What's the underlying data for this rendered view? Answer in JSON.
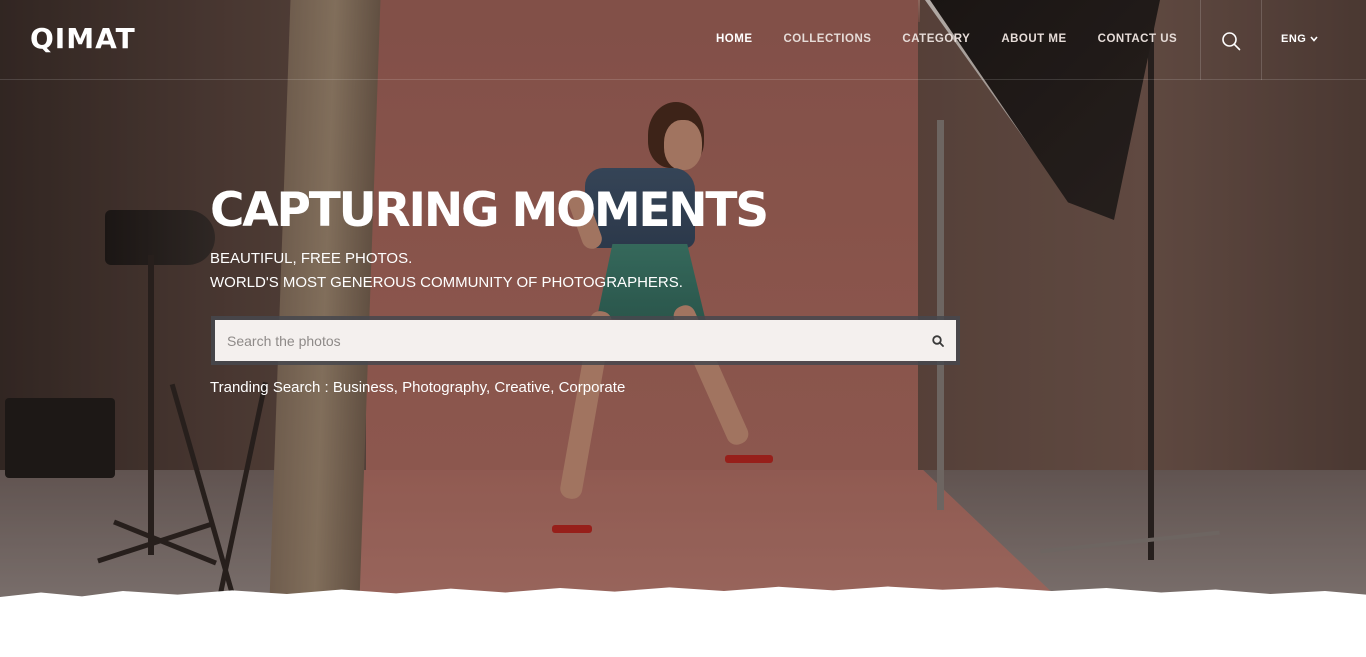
{
  "brand": {
    "logo": "QIMAT"
  },
  "nav": {
    "items": [
      {
        "label": "HOME",
        "active": true
      },
      {
        "label": "COLLECTIONS",
        "active": false
      },
      {
        "label": "CATEGORY",
        "active": false
      },
      {
        "label": "ABOUT ME",
        "active": false
      },
      {
        "label": "CONTACT US",
        "active": false
      }
    ],
    "search_icon": "search-icon",
    "language": {
      "label": "ENG",
      "icon": "chevron-down-icon"
    }
  },
  "hero": {
    "title": "CAPTURING MOMENTS",
    "subtitle_line1": "BEAUTIFUL, FREE PHOTOS.",
    "subtitle_line2": "WORLD'S MOST GENEROUS COMMUNITY OF PHOTOGRAPHERS.",
    "search": {
      "placeholder": "Search the photos",
      "value": "",
      "icon": "search-icon"
    },
    "trending": {
      "label": "Tranding Search :",
      "terms": [
        "Business",
        "Photography",
        "Creative",
        "Corporate"
      ]
    }
  },
  "colors": {
    "backdrop": "#b36e63",
    "search_frame": "#46484e",
    "search_field": "#f4f0ee",
    "text": "#ffffff"
  }
}
